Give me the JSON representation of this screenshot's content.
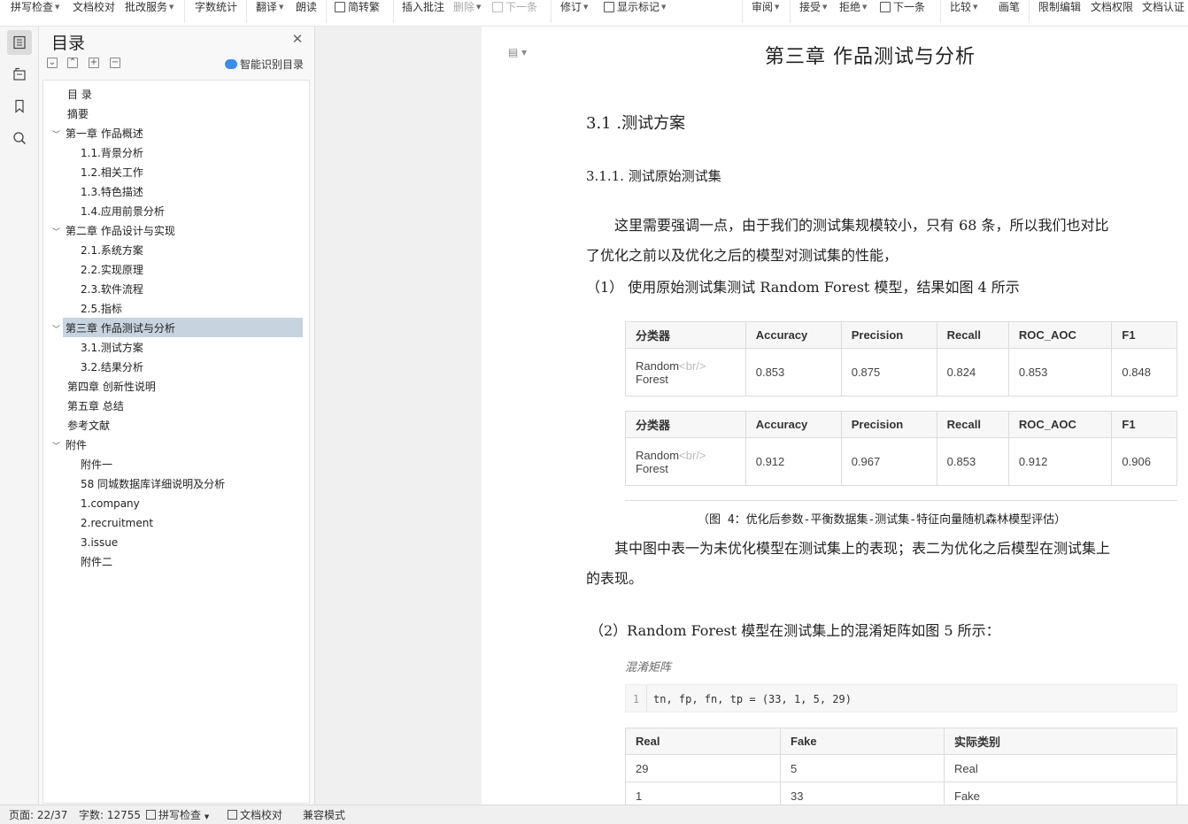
{
  "toolbar": {
    "items": [
      {
        "label": "拼写检查",
        "dropdown": true
      },
      {
        "label": "文档校对",
        "dropdown": false
      },
      {
        "label": "批改服务",
        "dropdown": true
      },
      {
        "label": "字数统计",
        "dropdown": false
      },
      {
        "label": "翻译",
        "dropdown": true
      },
      {
        "label": "朗读",
        "dropdown": false
      },
      {
        "label": "简转繁",
        "dropdown": false
      },
      {
        "label": "插入批注",
        "dropdown": false
      },
      {
        "label": "删除",
        "dropdown": true
      },
      {
        "label": "下一条",
        "dropdown": false
      },
      {
        "label": "修订",
        "dropdown": true
      },
      {
        "label": "显示标记",
        "dropdown": true
      },
      {
        "label": "审阅",
        "dropdown": true
      },
      {
        "label": "接受",
        "dropdown": true
      },
      {
        "label": "拒绝",
        "dropdown": true
      },
      {
        "label": "下一条",
        "dropdown": false
      },
      {
        "label": "比较",
        "dropdown": true
      },
      {
        "label": "画笔",
        "dropdown": false
      },
      {
        "label": "限制编辑",
        "dropdown": false
      },
      {
        "label": "文档权限",
        "dropdown": false
      },
      {
        "label": "文档认证",
        "dropdown": false
      }
    ]
  },
  "rail": {
    "icons": [
      "toc-icon",
      "navigation-icon",
      "bookmark-icon",
      "search-icon"
    ]
  },
  "toc": {
    "title": "目录",
    "smart_label": "智能识别目录",
    "items": [
      {
        "label": "目 录",
        "level": 1,
        "chevron": false
      },
      {
        "label": "摘要",
        "level": 1,
        "chevron": false
      },
      {
        "label": "第一章 作品概述",
        "level": 1,
        "chevron": true
      },
      {
        "label": "1.1.背景分析",
        "level": 2,
        "chevron": false
      },
      {
        "label": "1.2.相关工作",
        "level": 2,
        "chevron": false
      },
      {
        "label": "1.3.特色描述",
        "level": 2,
        "chevron": false
      },
      {
        "label": "1.4.应用前景分析",
        "level": 2,
        "chevron": false
      },
      {
        "label": "第二章 作品设计与实现",
        "level": 1,
        "chevron": true
      },
      {
        "label": "2.1.系统方案",
        "level": 2,
        "chevron": false
      },
      {
        "label": "2.2.实现原理",
        "level": 2,
        "chevron": false
      },
      {
        "label": "2.3.软件流程",
        "level": 2,
        "chevron": false
      },
      {
        "label": "2.5.指标",
        "level": 2,
        "chevron": false
      },
      {
        "label": "第三章 作品测试与分析",
        "level": 1,
        "chevron": true,
        "selected": true
      },
      {
        "label": "3.1.测试方案",
        "level": 2,
        "chevron": false
      },
      {
        "label": "3.2.结果分析",
        "level": 2,
        "chevron": false
      },
      {
        "label": "第四章 创新性说明",
        "level": 1,
        "chevron": false
      },
      {
        "label": "第五章 总结",
        "level": 1,
        "chevron": false
      },
      {
        "label": "参考文献",
        "level": 1,
        "chevron": false
      },
      {
        "label": "附件",
        "level": 1,
        "chevron": true
      },
      {
        "label": "附件一",
        "level": 2,
        "chevron": false
      },
      {
        "label": "58 同城数据库详细说明及分析",
        "level": 2,
        "chevron": false
      },
      {
        "label": "1.company",
        "level": 2,
        "chevron": false
      },
      {
        "label": "2.recruitment",
        "level": 2,
        "chevron": false
      },
      {
        "label": "3.issue",
        "level": 2,
        "chevron": false
      },
      {
        "label": "附件二",
        "level": 2,
        "chevron": false
      }
    ]
  },
  "doc": {
    "chapter_title": "第三章  作品测试与分析",
    "h31": "3.1 .测试方案",
    "h311": "3.1.1.   测试原始测试集",
    "para1_line1": "这里需要强调一点，由于我们的测试集规模较小，只有 68 条，所以我们也对比",
    "para1_line2": "了优化之前以及优化之后的模型对测试集的性能，",
    "item1": "（1）  使用原始测试集测试 Random Forest 模型，结果如图 4 所示",
    "table_headers": [
      "分类器",
      "Accuracy",
      "Precision",
      "Recall",
      "ROC_AOC",
      "F1"
    ],
    "table1": {
      "name_line1": "Random",
      "br_tag": "<br/>",
      "name_line2": "Forest",
      "values": [
        "0.853",
        "0.875",
        "0.824",
        "0.853",
        "0.848"
      ]
    },
    "table2": {
      "name_line1": "Random",
      "br_tag": "<br/>",
      "name_line2": "Forest",
      "values": [
        "0.912",
        "0.967",
        "0.853",
        "0.912",
        "0.906"
      ]
    },
    "caption": "（图 4：优化后参数-平衡数据集-测试集-特征向量随机森林模型评估）",
    "para2_line1": "其中图中表一为未优化模型在测试集上的表现；表二为优化之后模型在测试集上",
    "para2_line2": "的表现。",
    "item2": "（2）Random Forest 模型在测试集上的混淆矩阵如图 5 所示：",
    "code_label": "混淆矩阵",
    "code_line_no": "1",
    "code_text": "tn, fp, fn, tp = (33, 1, 5, 29)",
    "cm_headers": [
      "Real",
      "Fake",
      "实际类别"
    ],
    "cm_rows": [
      [
        "29",
        "5",
        "Real"
      ],
      [
        "1",
        "33",
        "Fake"
      ]
    ]
  },
  "status": {
    "page": "页面: 22/37",
    "words": "字数: 12755",
    "spell": "拼写检查",
    "proof": "文档校对",
    "compat": "兼容模式"
  }
}
